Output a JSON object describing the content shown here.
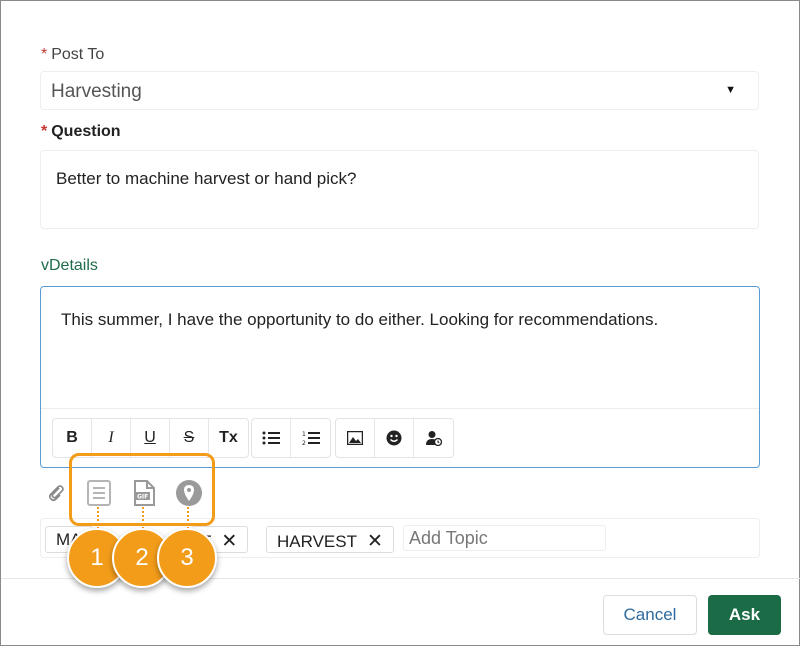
{
  "post_to": {
    "label": "Post To",
    "required_mark": "*",
    "selected": "Harvesting"
  },
  "question": {
    "label": "Question",
    "required_mark": "*",
    "value": "Better to machine harvest or hand pick?"
  },
  "details": {
    "toggle_glyph": "v",
    "label": "Details",
    "value": "This summer, I have the opportunity to do either. Looking for recommendations."
  },
  "toolbar": {
    "bold": "B",
    "italic": "I",
    "underline": "U",
    "strike": "S",
    "clear_format": "Tx",
    "icons": [
      "bold-icon",
      "italic-icon",
      "underline-icon",
      "strikethrough-icon",
      "clear-format-icon",
      "bullet-list-icon",
      "numbered-list-icon",
      "image-icon",
      "emoji-icon",
      "mention-icon"
    ]
  },
  "attachments": {
    "icons": [
      "paperclip-icon",
      "file-icon",
      "gif-icon",
      "location-icon"
    ]
  },
  "topics": {
    "chips": [
      "MA",
      "T",
      "HARVEST"
    ],
    "remove_glyph": "✕",
    "add_placeholder": "Add Topic"
  },
  "callouts": [
    "1",
    "2",
    "3"
  ],
  "buttons": {
    "cancel": "Cancel",
    "ask": "Ask"
  },
  "colors": {
    "accent": "#1c6b47",
    "highlight": "#f39c1a",
    "link": "#2d6b9e",
    "required": "#c23934"
  }
}
